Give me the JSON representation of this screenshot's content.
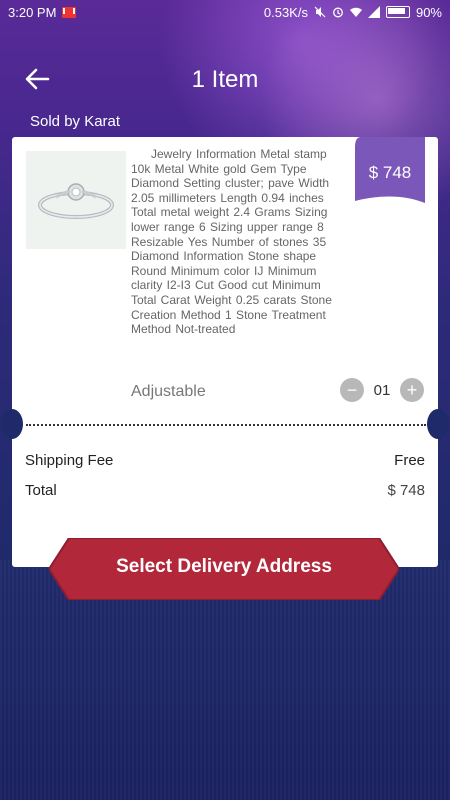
{
  "status_bar": {
    "time": "3:20 PM",
    "network_speed": "0.53K/s",
    "battery": "90%"
  },
  "header": {
    "title": "1 Item",
    "back_icon": "arrow-left-icon"
  },
  "seller": {
    "label": "Sold by Karat"
  },
  "item": {
    "description": "Jewelry Information Metal stamp 10k Metal White gold Gem Type Diamond Setting cluster; pave Width 2.05 millimeters Length 0.94 inches Total metal weight 2.4 Grams Sizing lower range 6 Sizing upper range 8 Resizable Yes Number of stones 35 Diamond Information Stone shape Round Minimum color IJ Minimum clarity I2-I3 Cut Good cut Minimum Total Carat Weight 0.25 carats Stone Creation Method 1 Stone Treatment Method Not-treated",
    "price": "$ 748",
    "variant": "Adjustable",
    "quantity": "01",
    "minus": "−",
    "plus": "+"
  },
  "summary": {
    "shipping_label": "Shipping Fee",
    "shipping_value": "Free",
    "total_label": "Total",
    "total_value": "$ 748"
  },
  "cta": {
    "label": "Select Delivery Address"
  },
  "colors": {
    "price_tag": "#7a57b8",
    "cta": "#b3273b",
    "stepper": "#b8b8b8"
  }
}
